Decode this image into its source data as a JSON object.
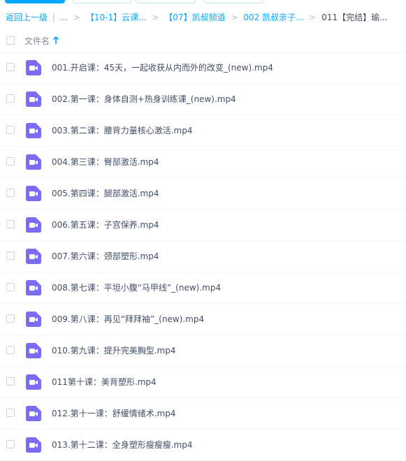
{
  "breadcrumb": {
    "back": "返回上一级",
    "divider": "|",
    "ellipsis": "...",
    "items": [
      "【10-1】云课...",
      "【07】凯叔频道",
      "002 凯叔亲子...",
      "011【完结】瑜..."
    ],
    "separator": ">"
  },
  "header": {
    "filename_label": "文件名",
    "sort": "ascending",
    "sort_icon": "arrow-up-icon"
  },
  "files": [
    {
      "name": "001.开启课：45天，一起收获从内而外的改变_(new).mp4"
    },
    {
      "name": "002.第一课：身体自测+热身训练课_(new).mp4"
    },
    {
      "name": "003.第二课：腰背力量核心激活.mp4"
    },
    {
      "name": "004.第三课：臀部激活.mp4"
    },
    {
      "name": "005.第四课：腿部激活.mp4"
    },
    {
      "name": "006.第五课：子宫保养.mp4"
    },
    {
      "name": "007.第六课：颈部塑形.mp4"
    },
    {
      "name": "008.第七课：平坦小腹“马甲线”_(new).mp4"
    },
    {
      "name": "009.第八课：再见“拜拜袖”_(new).mp4"
    },
    {
      "name": "010.第九课：提升完美胸型.mp4"
    },
    {
      "name": "011第十课：美背塑形.mp4"
    },
    {
      "name": "012.第十一课：舒缓情绪术.mp4"
    },
    {
      "name": "013.第十二课：全身塑形瘦瘦瘦.mp4"
    }
  ],
  "colors": {
    "accent": "#06a7ff",
    "video_icon": "#7a6df3",
    "text": "#424e67"
  },
  "icons": {
    "file": "video-file-icon"
  }
}
